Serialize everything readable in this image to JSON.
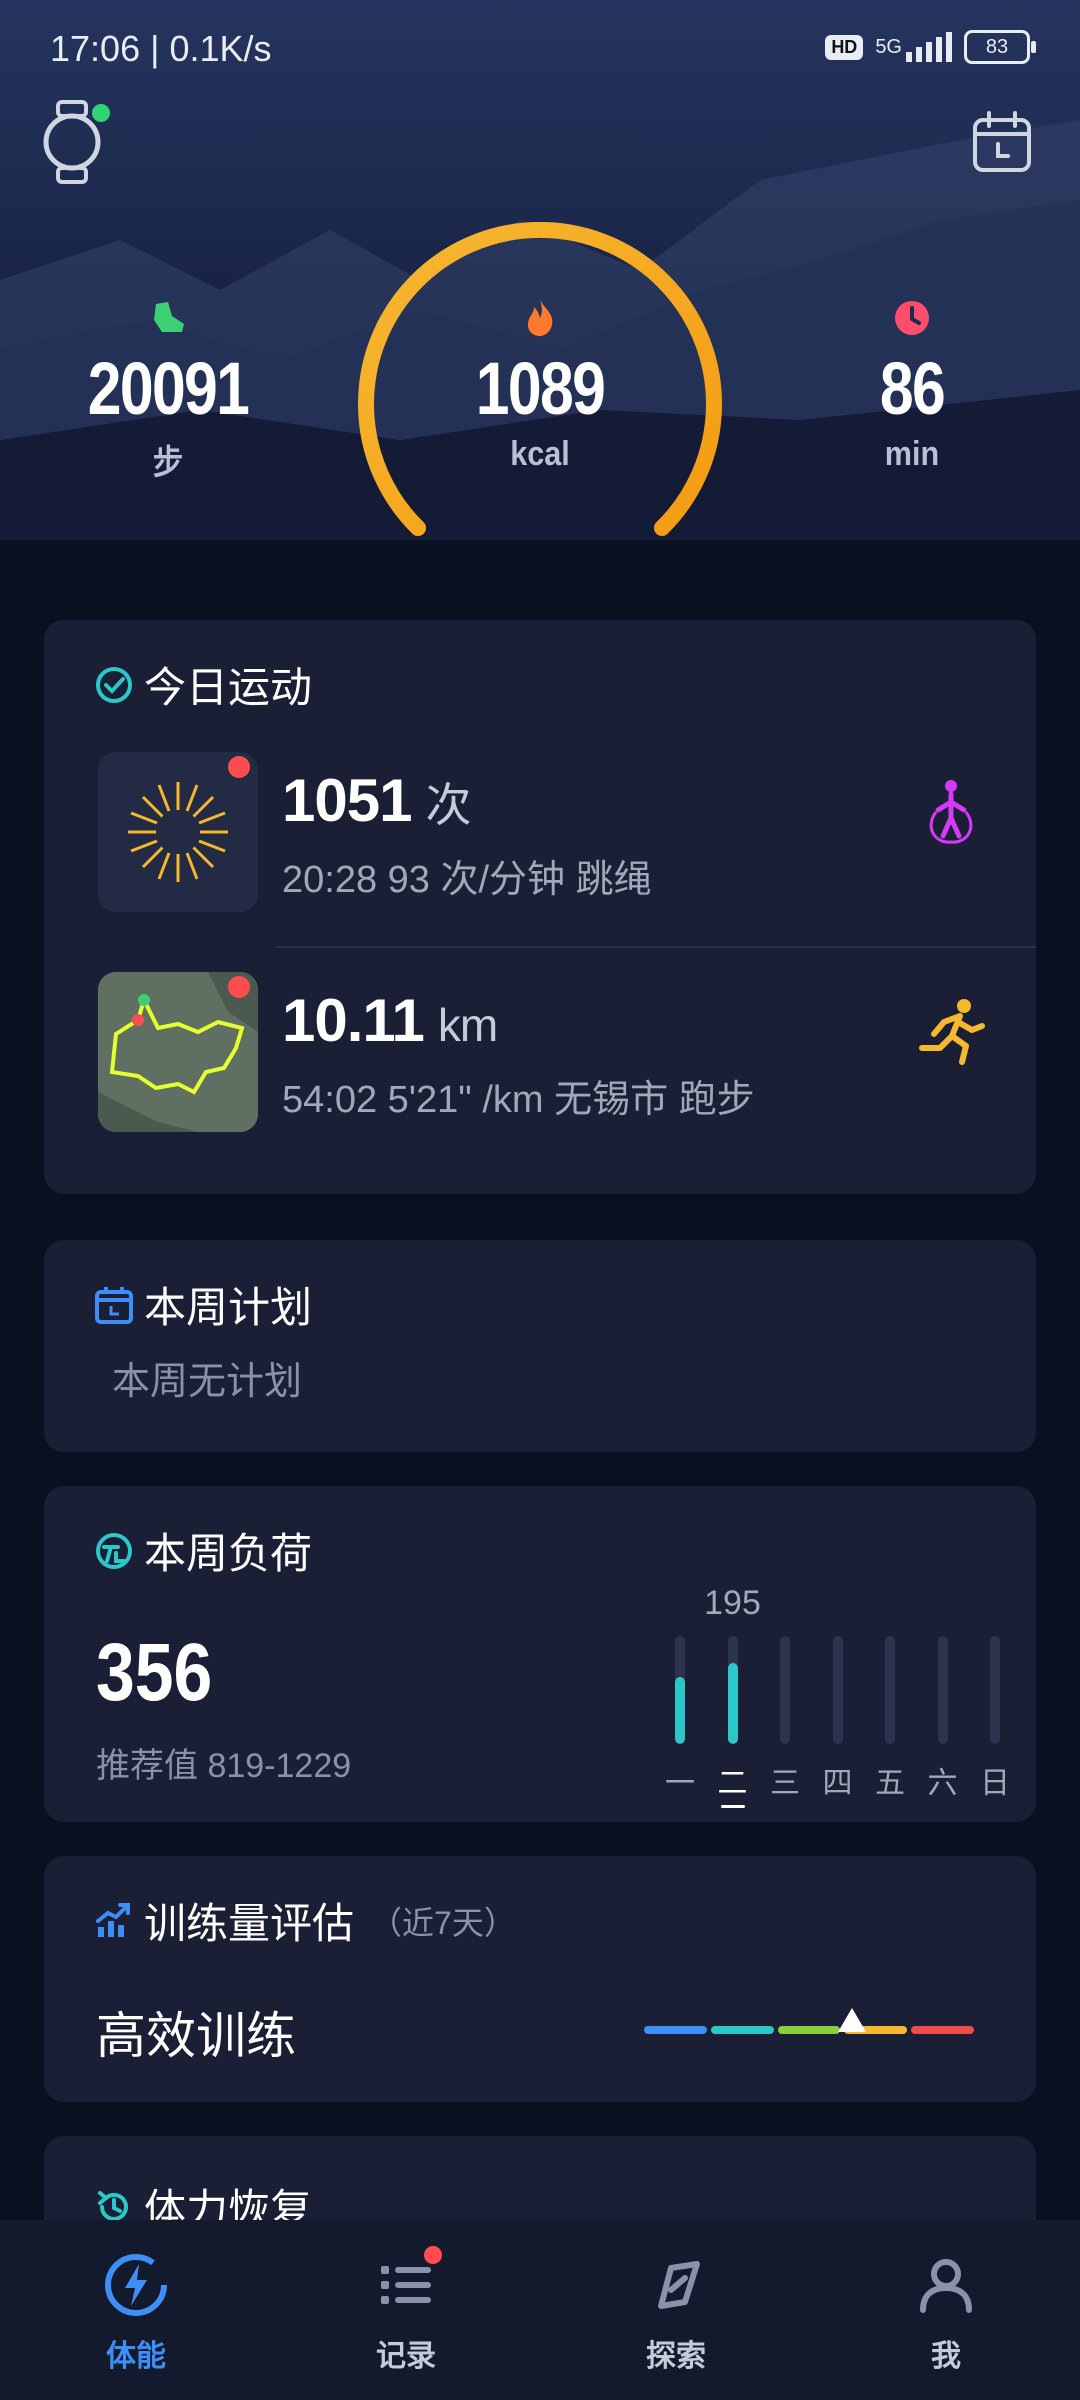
{
  "status_bar": {
    "time_text": "17:06 | 0.1K/s",
    "hd": "HD",
    "network": "5G",
    "battery": "83"
  },
  "header": {
    "watch_icon": "watch-icon",
    "calendar_icon": "calendar-icon"
  },
  "summary": {
    "steps": {
      "value": "20091",
      "unit": "步"
    },
    "calories": {
      "value": "1089",
      "unit": "kcal"
    },
    "minutes": {
      "value": "86",
      "unit": "min"
    },
    "accent": "#f5a623"
  },
  "today": {
    "title": "今日运动",
    "activities": [
      {
        "main": "1051",
        "main_unit": "次",
        "sub": "20:28 93 次/分钟  跳绳",
        "icon": "jump-rope-icon"
      },
      {
        "main": "10.11",
        "main_unit": "km",
        "sub": "54:02 5'21\" /km  无锡市 跑步",
        "icon": "running-icon"
      }
    ]
  },
  "weekly_plan": {
    "title": "本周计划",
    "empty_text": "本周无计划"
  },
  "weekly_load": {
    "title": "本周负荷",
    "value": "356",
    "recommend": "推荐值 819-1229",
    "peak_label": "195",
    "days": [
      "一",
      "二",
      "三",
      "四",
      "五",
      "六",
      "日"
    ],
    "levels": [
      0.62,
      0.75,
      0,
      0,
      0,
      0,
      0
    ],
    "current_day_index": 1
  },
  "training": {
    "title": "训练量评估",
    "subtitle": "（近7天）",
    "status": "高效训练",
    "scale_colors": [
      "#3e8ef7",
      "#2cc7c9",
      "#8ccf3a",
      "#f5b82e",
      "#ef4b4b"
    ],
    "position": 0.63
  },
  "recovery": {
    "title": "体力恢复"
  },
  "tabbar": {
    "tabs": [
      {
        "label": "体能",
        "icon": "fitness-icon"
      },
      {
        "label": "记录",
        "icon": "list-icon"
      },
      {
        "label": "探索",
        "icon": "compass-icon"
      },
      {
        "label": "我",
        "icon": "profile-icon"
      }
    ]
  }
}
